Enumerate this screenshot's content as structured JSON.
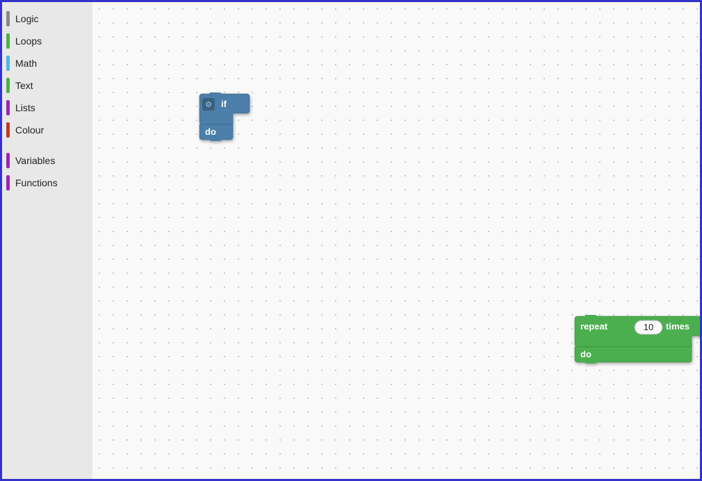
{
  "sidebar": {
    "items": [
      {
        "id": "logic",
        "label": "Logic",
        "color": "#888888"
      },
      {
        "id": "loops",
        "label": "Loops",
        "color": "#4CAF50"
      },
      {
        "id": "math",
        "label": "Math",
        "color": "#4db6e4"
      },
      {
        "id": "text",
        "label": "Text",
        "color": "#4CAF50"
      },
      {
        "id": "lists",
        "label": "Lists",
        "color": "#9c27b0"
      },
      {
        "id": "colour",
        "label": "Colour",
        "color": "#c0392b"
      },
      {
        "id": "variables",
        "label": "Variables",
        "color": "#9c27b0"
      },
      {
        "id": "functions",
        "label": "Functions",
        "color": "#9c27b0"
      }
    ]
  },
  "blocks": {
    "if_block": {
      "if_label": "if",
      "do_label": "do",
      "color": "#4c7ea8"
    },
    "repeat_block": {
      "repeat_label": "repeat",
      "times_label": "times",
      "do_label": "do",
      "value": "10",
      "color_main": "#4CAF50",
      "color_value_bg": "#f5f5f5"
    }
  },
  "canvas": {
    "dot_color": "#cccccc"
  }
}
